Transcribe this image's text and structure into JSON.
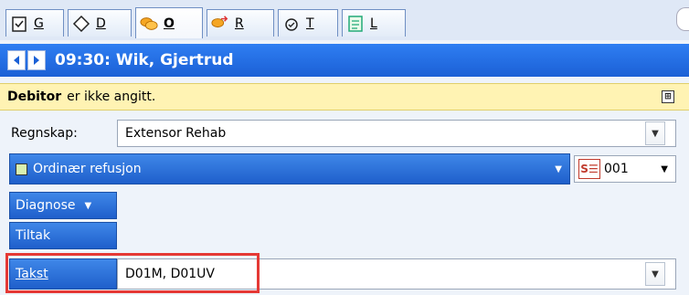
{
  "tabs": [
    {
      "icon": "clipboard-check-icon",
      "key": "G"
    },
    {
      "icon": "diamond-icon",
      "key": "D"
    },
    {
      "icon": "coins-icon",
      "key": "O",
      "active": true
    },
    {
      "icon": "coins-arrow-icon",
      "key": "R"
    },
    {
      "icon": "stethoscope-icon",
      "key": "T"
    },
    {
      "icon": "list-check-icon",
      "key": "L"
    }
  ],
  "header": {
    "title": "09:30: Wik, Gjertrud"
  },
  "notice": {
    "bold": "Debitor",
    "text": "er ikke angitt.",
    "expand": "⊞"
  },
  "regnskap": {
    "label": "Regnskap:",
    "value": "Extensor Rehab"
  },
  "refusjon": {
    "label": "Ordinær refusjon",
    "code": "001",
    "code_icon": "S☰"
  },
  "buttons": {
    "diagnose": "Diagnose",
    "tiltak": "Tiltak",
    "takst": "Takst"
  },
  "takst": {
    "value": "D01M, D01UV"
  },
  "colors": {
    "header": "#1b60d6",
    "notice": "#fff3b3",
    "highlight": "#e53935"
  }
}
